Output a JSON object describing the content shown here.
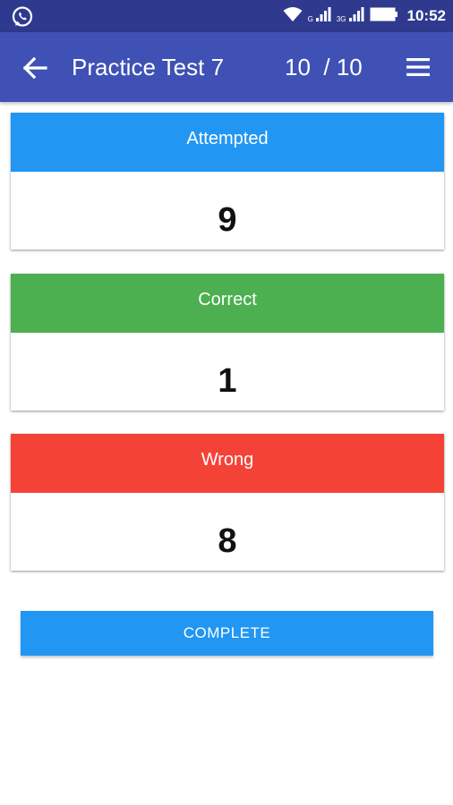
{
  "status_bar": {
    "time": "10:52",
    "network_label_1": "G",
    "network_label_2": "3G",
    "icons": [
      "whatsapp-icon",
      "wifi-icon",
      "signal-icon",
      "battery-icon"
    ]
  },
  "app_bar": {
    "title": "Practice Test 7",
    "progress": "10  / 10",
    "color": "#3f51b5"
  },
  "results": [
    {
      "label": "Attempted",
      "value": "9",
      "color": "#2196f3"
    },
    {
      "label": "Correct",
      "value": "1",
      "color": "#4caf50"
    },
    {
      "label": "Wrong",
      "value": "8",
      "color": "#f44336"
    }
  ],
  "complete_button": {
    "label": "COMPLETE",
    "color": "#2196f3"
  }
}
